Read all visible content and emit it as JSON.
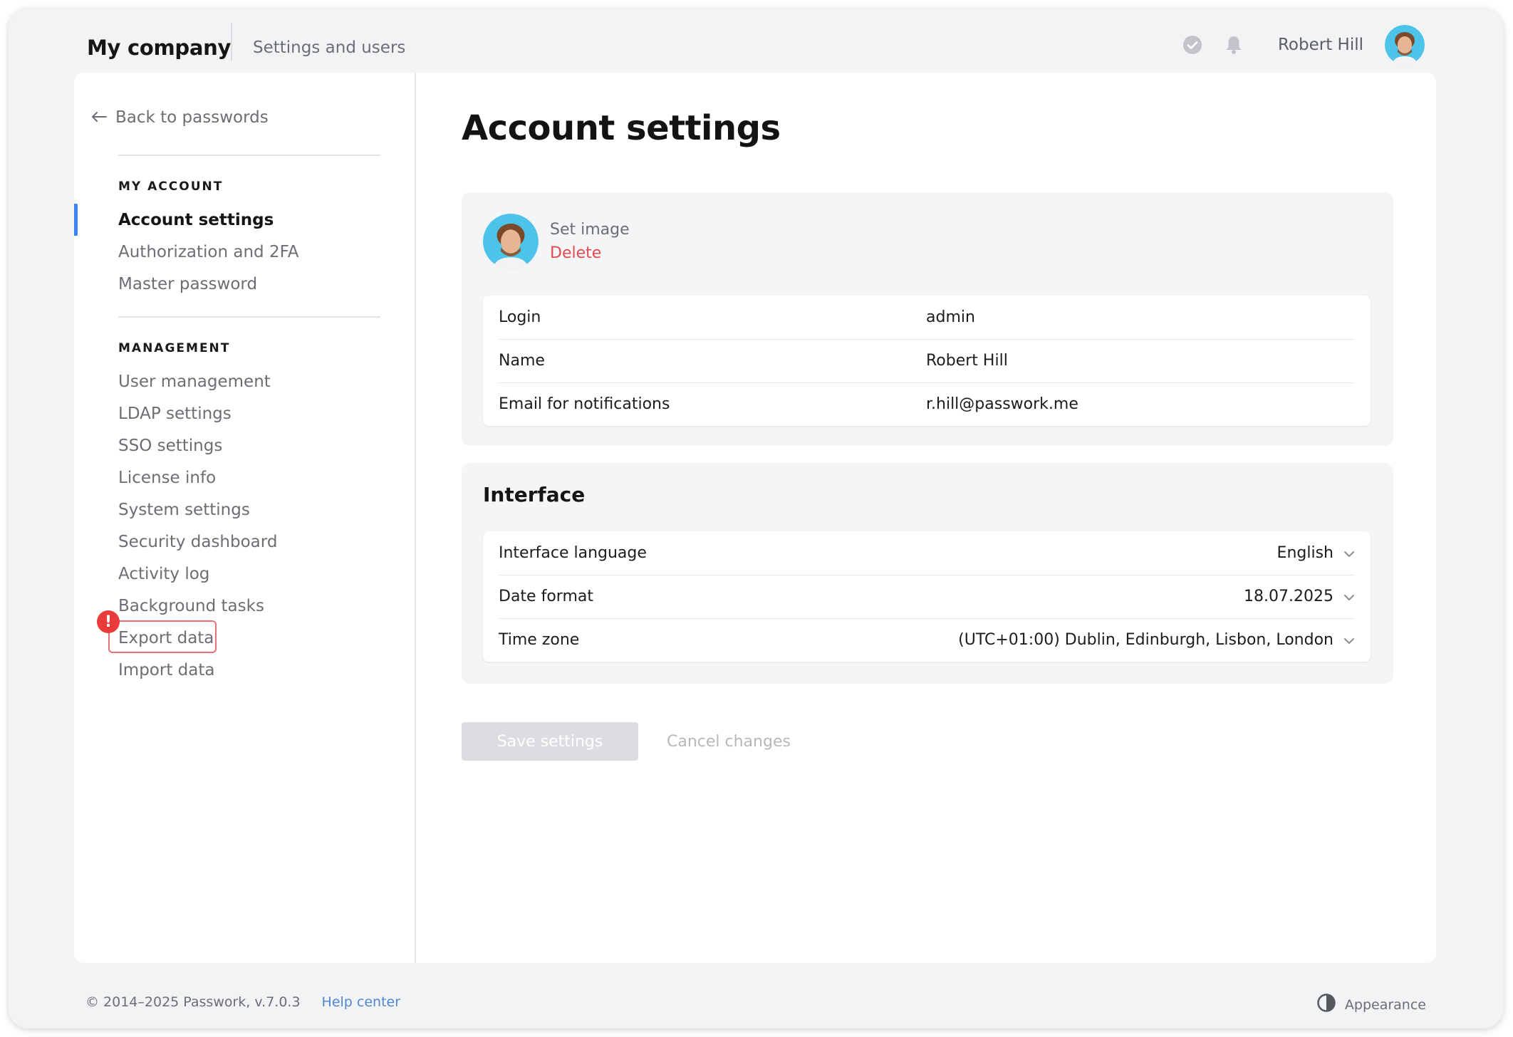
{
  "header": {
    "brand": "My company",
    "section": "Settings and users",
    "user_name": "Robert Hill"
  },
  "sidebar": {
    "back": "Back to passwords",
    "groups": [
      {
        "heading": "MY ACCOUNT",
        "items": [
          {
            "label": "Account settings",
            "active": true
          },
          {
            "label": "Authorization and 2FA"
          },
          {
            "label": "Master password"
          }
        ]
      },
      {
        "heading": "MANAGEMENT",
        "items": [
          {
            "label": "User management"
          },
          {
            "label": "LDAP settings"
          },
          {
            "label": "SSO settings"
          },
          {
            "label": "License info"
          },
          {
            "label": "System settings"
          },
          {
            "label": "Security dashboard"
          },
          {
            "label": "Activity log"
          },
          {
            "label": "Background tasks"
          },
          {
            "label": "Export data",
            "highlighted": true
          },
          {
            "label": "Import data"
          }
        ]
      }
    ],
    "alert_symbol": "!"
  },
  "main": {
    "title": "Account settings",
    "profile": {
      "set_image": "Set image",
      "delete": "Delete",
      "fields": [
        {
          "label": "Login",
          "value": "admin"
        },
        {
          "label": "Name",
          "value": "Robert Hill"
        },
        {
          "label": "Email for notifications",
          "value": "r.hill@passwork.me"
        }
      ]
    },
    "interface": {
      "title": "Interface",
      "fields": [
        {
          "label": "Interface language",
          "value": "English"
        },
        {
          "label": "Date format",
          "value": "18.07.2025"
        },
        {
          "label": "Time zone",
          "value": "(UTC+01:00) Dublin, Edinburgh, Lisbon, London"
        }
      ]
    },
    "save_label": "Save settings",
    "cancel_label": "Cancel changes"
  },
  "footer": {
    "copyright": "© 2014–2025 Passwork, v.7.0.3",
    "help": "Help center",
    "appearance": "Appearance"
  },
  "colors": {
    "accent": "#3b82f6",
    "danger": "#e5484d",
    "link": "#4f86d6"
  }
}
